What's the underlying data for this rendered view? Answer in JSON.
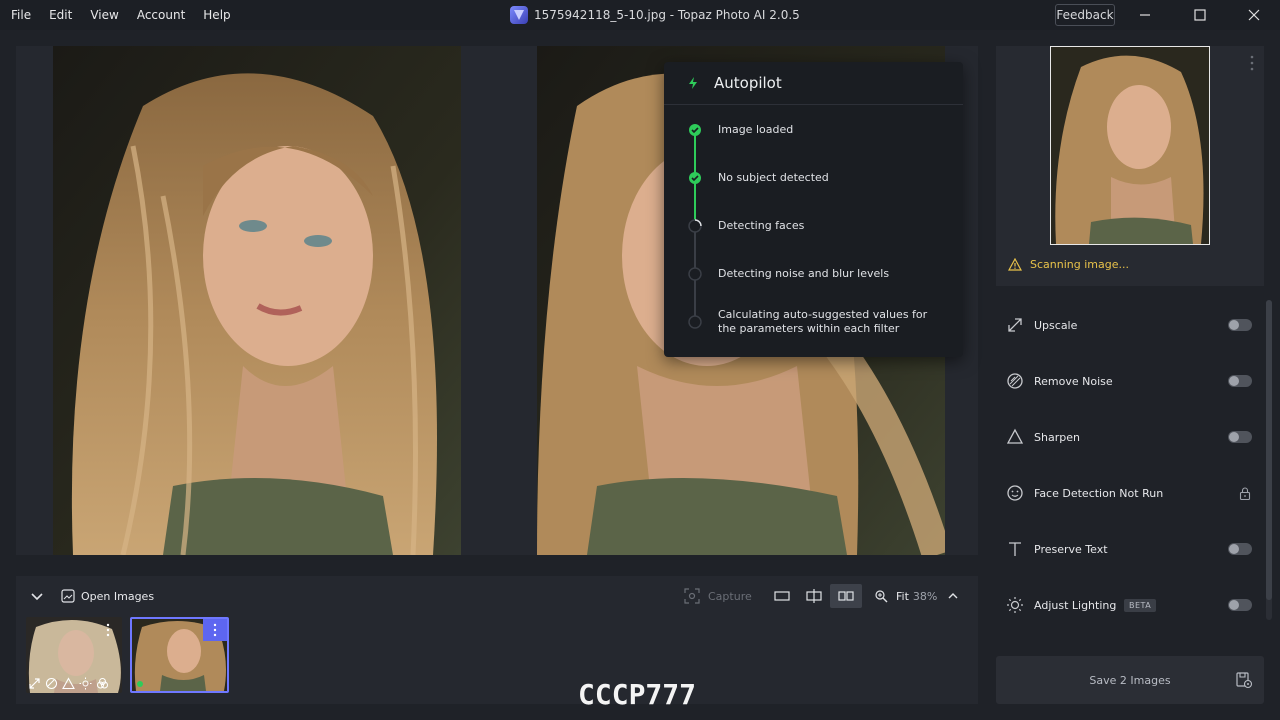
{
  "menu": [
    "File",
    "Edit",
    "View",
    "Account",
    "Help"
  ],
  "window_title": "1575942118_5-10.jpg - Topaz Photo AI 2.0.5",
  "feedback_label": "Feedback",
  "autopilot": {
    "title": "Autopilot",
    "steps": [
      {
        "label": "Image loaded",
        "status": "done"
      },
      {
        "label": "No subject detected",
        "status": "done"
      },
      {
        "label": "Detecting faces",
        "status": "in-progress"
      },
      {
        "label": "Detecting noise and blur levels",
        "status": "pending"
      },
      {
        "label": "Calculating auto-suggested values for the parameters within each filter",
        "status": "pending"
      }
    ]
  },
  "status": {
    "scanning": "Scanning image..."
  },
  "filters": [
    {
      "label": "Upscale",
      "icon": "upscale-icon",
      "control": "toggle"
    },
    {
      "label": "Remove Noise",
      "icon": "remove-noise-icon",
      "control": "toggle"
    },
    {
      "label": "Sharpen",
      "icon": "sharpen-icon",
      "control": "toggle"
    },
    {
      "label": "Face Detection Not Run",
      "icon": "face-icon",
      "control": "lock"
    },
    {
      "label": "Preserve Text",
      "icon": "text-icon",
      "control": "toggle"
    },
    {
      "label": "Adjust Lighting",
      "icon": "lighting-icon",
      "control": "toggle",
      "badge": "BETA"
    }
  ],
  "save_label": "Save 2 Images",
  "bottom": {
    "open_images": "Open Images",
    "capture": "Capture",
    "zoom_label": "Fit",
    "zoom_value": "38%"
  },
  "watermark": "CCCP777",
  "colors": {
    "accent": "#6f78ff",
    "success": "#2ecc5a",
    "warning": "#e8c24a"
  }
}
